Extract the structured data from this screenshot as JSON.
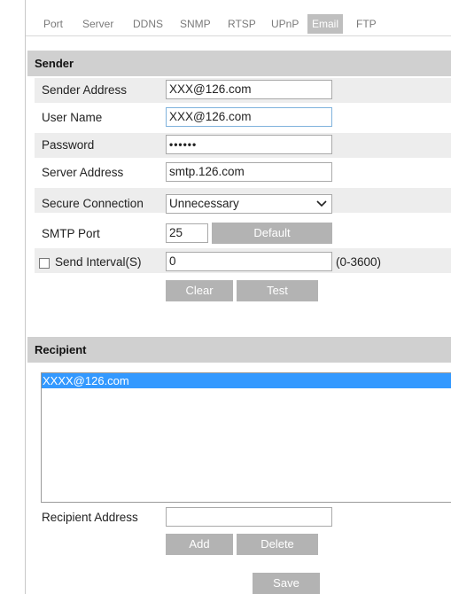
{
  "tabs": [
    "Port",
    "Server",
    "DDNS",
    "SNMP",
    "RTSP",
    "UPnP",
    "Email",
    "FTP"
  ],
  "active_tab": "Email",
  "sender": {
    "header": "Sender",
    "sender_address": {
      "label": "Sender Address",
      "value": "XXX@126.com"
    },
    "user_name": {
      "label": "User Name",
      "value": "XXX@126.com"
    },
    "password": {
      "label": "Password",
      "value": "••••••"
    },
    "server_address": {
      "label": "Server Address",
      "value": "smtp.126.com"
    },
    "secure_connection": {
      "label": "Secure Connection",
      "value": "Unnecessary"
    },
    "smtp_port": {
      "label": "SMTP Port",
      "value": "25",
      "default_label": "Default"
    },
    "send_interval": {
      "label": "Send Interval(S)",
      "value": "0",
      "range": "(0-3600)",
      "checked": false
    },
    "clear_label": "Clear",
    "test_label": "Test"
  },
  "recipient": {
    "header": "Recipient",
    "list": [
      "XXXX@126.com"
    ],
    "address_label": "Recipient Address",
    "address_value": "",
    "add_label": "Add",
    "delete_label": "Delete"
  },
  "save_label": "Save",
  "icons": {
    "dropdown": "chevron-down-icon",
    "checkbox": "checkbox-icon"
  },
  "colors": {
    "section_header": "#d0d0d0",
    "row_background": "#ededed",
    "button": "#b3b3b3",
    "active_tab": "#bfbfbf",
    "list_selection": "#3399ff"
  }
}
